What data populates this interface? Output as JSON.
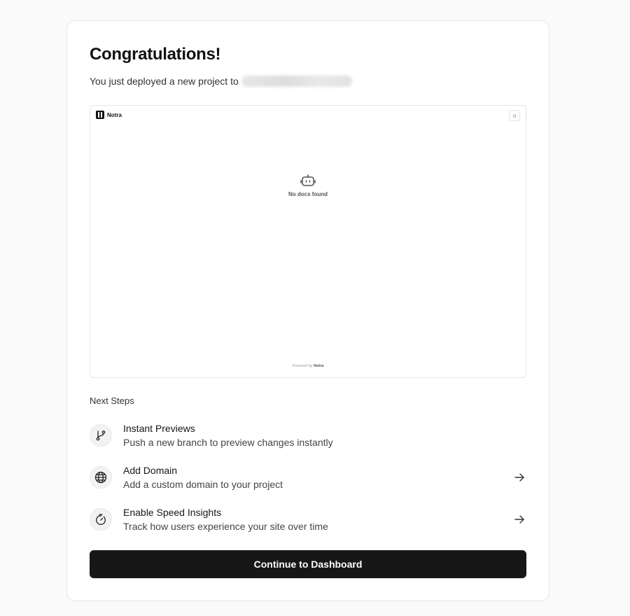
{
  "header": {
    "title": "Congratulations!",
    "subtitle": "You just deployed a new project to"
  },
  "preview": {
    "logo_text": "Notra",
    "theme_icon": "sun-icon",
    "empty_state": "No docs found",
    "footer_prefix": "Powered by",
    "footer_brand": "Notra"
  },
  "next_steps": {
    "label": "Next Steps",
    "items": [
      {
        "title": "Instant Previews",
        "description": "Push a new branch to preview changes instantly",
        "icon": "git-branch-icon"
      },
      {
        "title": "Add Domain",
        "description": "Add a custom domain to your project",
        "icon": "globe-icon"
      },
      {
        "title": "Enable Speed Insights",
        "description": "Track how users experience your site over time",
        "icon": "timer-icon"
      }
    ]
  },
  "cta": {
    "label": "Continue to Dashboard"
  },
  "colors": {
    "primary_button": "#171717",
    "background": "#fafafa",
    "card": "#ffffff",
    "border": "#e5e5e5"
  }
}
